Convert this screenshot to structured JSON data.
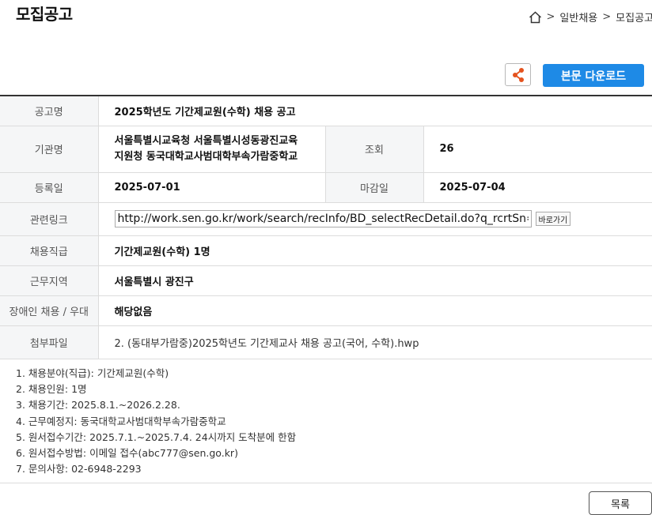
{
  "header": {
    "title": "모집공고",
    "breadcrumb": [
      "일반채용",
      "모집공고"
    ],
    "breadcrumb_sep": ">"
  },
  "toolbar": {
    "share_icon": "share-icon",
    "download_label": "본문 다운로드"
  },
  "info": {
    "notice_label": "공고명",
    "notice_value": "2025학년도 기간제교원(수학) 채용 공고",
    "org_label": "기관명",
    "org_value_line1": "서울특별시교육청 서울특별시성동광진교육",
    "org_value_line2": "지원청 동국대학교사범대학부속가람중학교",
    "views_label": "조회",
    "views_value": "26",
    "reg_label": "등록일",
    "reg_value": "2025-07-01",
    "deadline_label": "마감일",
    "deadline_value": "2025-07-04",
    "link_label": "관련링크",
    "link_value": "http://work.sen.go.kr/work/search/recInfo/BD_selectRecDetail.do?q_rcrtSn=",
    "link_button": "바로가기",
    "position_label": "채용직급",
    "position_value": "기간제교원(수학) 1명",
    "location_label": "근무지역",
    "location_value": "서울특별시 광진구",
    "disability_label": "장애인 채용 / 우대",
    "disability_value": "해당없음",
    "attach_label": "첨부파일",
    "attach_value": "2. (동대부가람중)2025학년도 기간제교사 채용 공고(국어, 수학).hwp"
  },
  "details": [
    "1. 채용분야(직급): 기간제교원(수학)",
    "2. 채용인원: 1명",
    "3. 채용기간: 2025.8.1.~2026.2.28.",
    "4. 근무예정지: 동국대학교사범대학부속가람중학교",
    "5. 원서접수기간: 2025.7.1.~2025.7.4. 24시까지 도착분에 한함",
    "6. 원서접수방법: 이메일 접수(abc777@sen.go.kr)",
    "7. 문의사항: 02-6948-2293"
  ],
  "footer": {
    "list_button": "목록"
  },
  "colors": {
    "accent": "#1e8ae6",
    "share_icon": "#e5531e",
    "label_bg": "#f5f6f7"
  }
}
